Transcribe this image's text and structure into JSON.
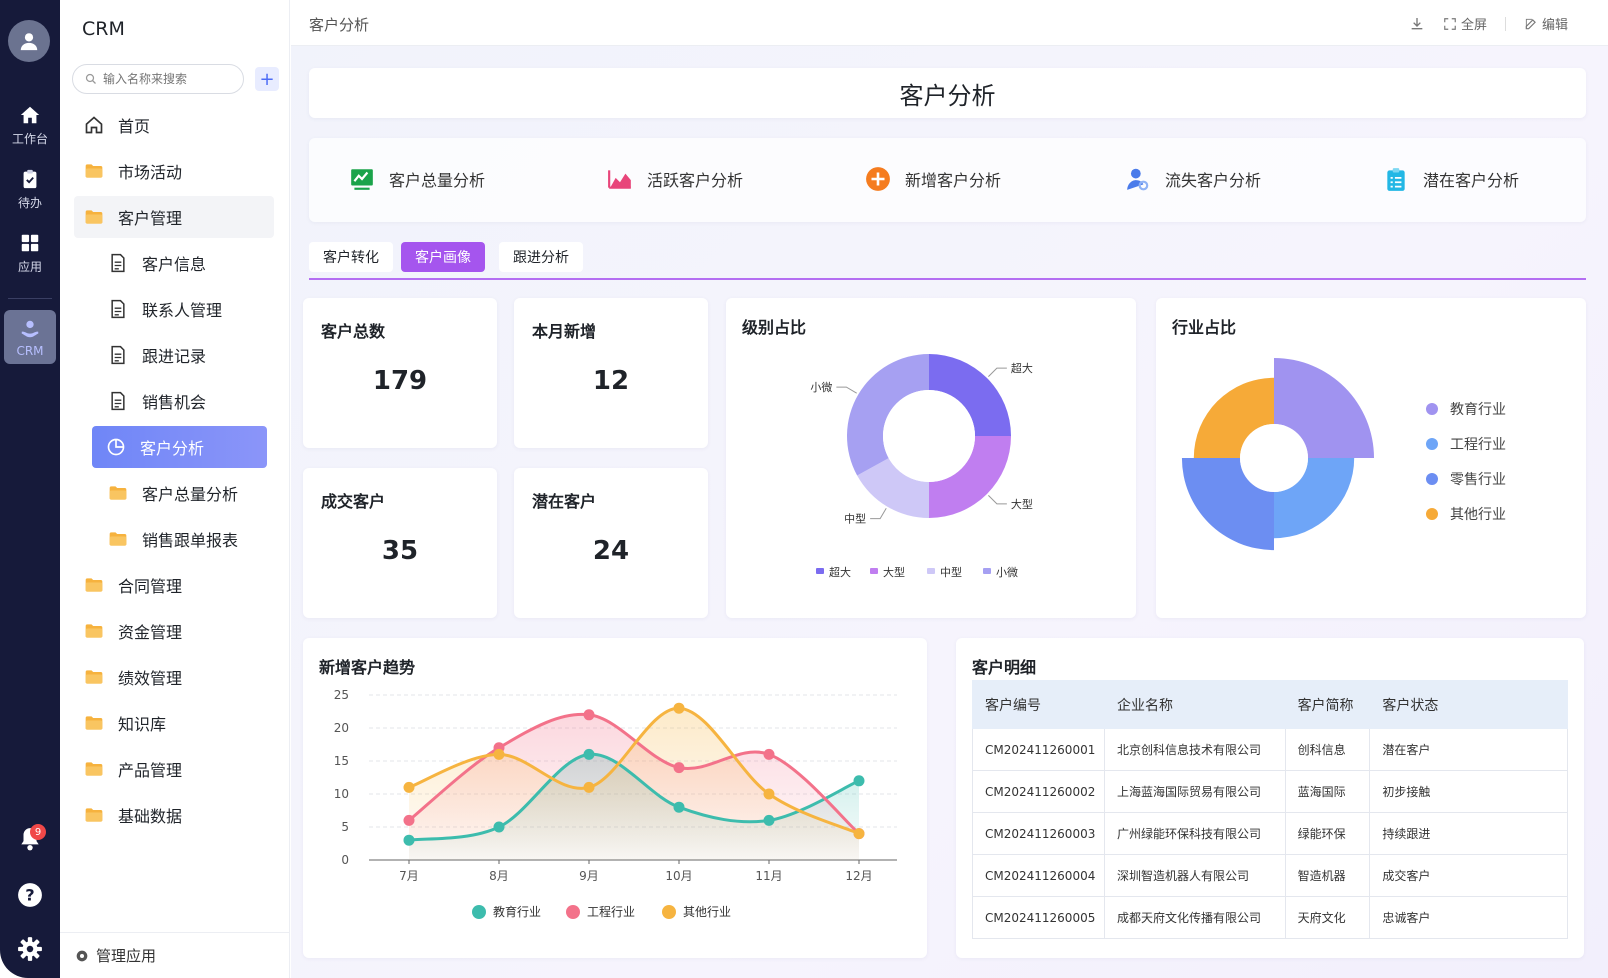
{
  "rail": {
    "items": [
      {
        "label": "工作台",
        "icon": "home-icon"
      },
      {
        "label": "待办",
        "icon": "clipboard-icon"
      },
      {
        "label": "应用",
        "icon": "apps-grid-icon"
      },
      {
        "label": "CRM",
        "icon": "crm-user-icon"
      }
    ],
    "notification_count": "9"
  },
  "sidebar": {
    "brand": "CRM",
    "search_placeholder": "输入名称来搜索",
    "menu": [
      {
        "label": "首页",
        "icon": "home-outline-icon"
      },
      {
        "label": "市场活动",
        "icon": "folder-icon"
      },
      {
        "label": "客户管理",
        "icon": "folder-icon"
      },
      {
        "label": "客户信息",
        "icon": "document-icon"
      },
      {
        "label": "联系人管理",
        "icon": "document-icon"
      },
      {
        "label": "跟进记录",
        "icon": "document-icon"
      },
      {
        "label": "销售机会",
        "icon": "document-icon"
      },
      {
        "label": "客户分析",
        "icon": "pie-icon"
      },
      {
        "label": "客户总量分析",
        "icon": "folder-icon"
      },
      {
        "label": "销售跟单报表",
        "icon": "folder-icon"
      },
      {
        "label": "合同管理",
        "icon": "folder-icon"
      },
      {
        "label": "资金管理",
        "icon": "folder-icon"
      },
      {
        "label": "绩效管理",
        "icon": "folder-icon"
      },
      {
        "label": "知识库",
        "icon": "folder-icon"
      },
      {
        "label": "产品管理",
        "icon": "folder-icon"
      },
      {
        "label": "基础数据",
        "icon": "folder-icon"
      }
    ],
    "manage_label": "管理应用"
  },
  "topbar": {
    "breadcrumb": "客户分析",
    "fullscreen_label": "全屏",
    "edit_label": "编辑"
  },
  "page": {
    "title": "客户分析",
    "quick_links": [
      {
        "label": "客户总量分析",
        "icon": "trend-chart-icon",
        "color": "#1aa34a"
      },
      {
        "label": "活跃客户分析",
        "icon": "area-chart-icon",
        "color": "#e8457a"
      },
      {
        "label": "新增客户分析",
        "icon": "plus-circle-icon",
        "color": "#f57c1f"
      },
      {
        "label": "流失客户分析",
        "icon": "user-search-icon",
        "color": "#4a7bea"
      },
      {
        "label": "潜在客户分析",
        "icon": "clipboard-list-icon",
        "color": "#23b7e5"
      }
    ],
    "tabs": [
      {
        "label": "客户转化"
      },
      {
        "label": "客户画像"
      },
      {
        "label": "跟进分析"
      }
    ],
    "kpis": [
      {
        "label": "客户总数",
        "value": "179"
      },
      {
        "label": "本月新增",
        "value": "12"
      },
      {
        "label": "成交客户",
        "value": "35"
      },
      {
        "label": "潜在客户",
        "value": "24"
      }
    ],
    "level_title": "级别占比",
    "industry_title": "行业占比",
    "trend_title": "新增客户趋势",
    "detail_title": "客户明细"
  },
  "chart_data": [
    {
      "type": "pie",
      "title": "级别占比",
      "variant": "donut",
      "categories": [
        "超大",
        "大型",
        "中型",
        "小微"
      ],
      "values": [
        25,
        25,
        17,
        33
      ],
      "colors": [
        "#7b6cf0",
        "#c07ef0",
        "#cec8f7",
        "#a6a0f2"
      ],
      "legend": "bottom"
    },
    {
      "type": "pie",
      "title": "行业占比",
      "variant": "rose",
      "categories": [
        "教育行业",
        "工程行业",
        "零售行业",
        "其他行业"
      ],
      "values": [
        100,
        70,
        88,
        70
      ],
      "colors": [
        "#a093f0",
        "#6ea5f7",
        "#6c8ef2",
        "#f6aa38"
      ],
      "legend": "right"
    },
    {
      "type": "line",
      "title": "新增客户趋势",
      "smooth": true,
      "area": true,
      "categories": [
        "7月",
        "8月",
        "9月",
        "10月",
        "11月",
        "12月"
      ],
      "series": [
        {
          "name": "教育行业",
          "color": "#3dbcad",
          "values": [
            3,
            5,
            16,
            8,
            6,
            12
          ]
        },
        {
          "name": "工程行业",
          "color": "#f3728a",
          "values": [
            6,
            17,
            22,
            14,
            16,
            4
          ]
        },
        {
          "name": "其他行业",
          "color": "#f6b440",
          "values": [
            11,
            16,
            11,
            23,
            10,
            4
          ]
        }
      ],
      "ylim": [
        0,
        25
      ],
      "yticks": [
        0,
        5,
        10,
        15,
        20,
        25
      ],
      "grid": true,
      "legend": "bottom"
    }
  ],
  "detail_table": {
    "columns": [
      "客户编号",
      "企业名称",
      "客户简称",
      "客户状态"
    ],
    "rows": [
      [
        "CM202411260001",
        "北京创科信息技术有限公司",
        "创科信息",
        "潜在客户"
      ],
      [
        "CM202411260002",
        "上海蓝海国际贸易有限公司",
        "蓝海国际",
        "初步接触"
      ],
      [
        "CM202411260003",
        "广州绿能环保科技有限公司",
        "绿能环保",
        "持续跟进"
      ],
      [
        "CM202411260004",
        "深圳智造机器人有限公司",
        "智造机器",
        "成交客户"
      ],
      [
        "CM202411260005",
        "成都天府文化传播有限公司",
        "天府文化",
        "忠诚客户"
      ]
    ]
  }
}
